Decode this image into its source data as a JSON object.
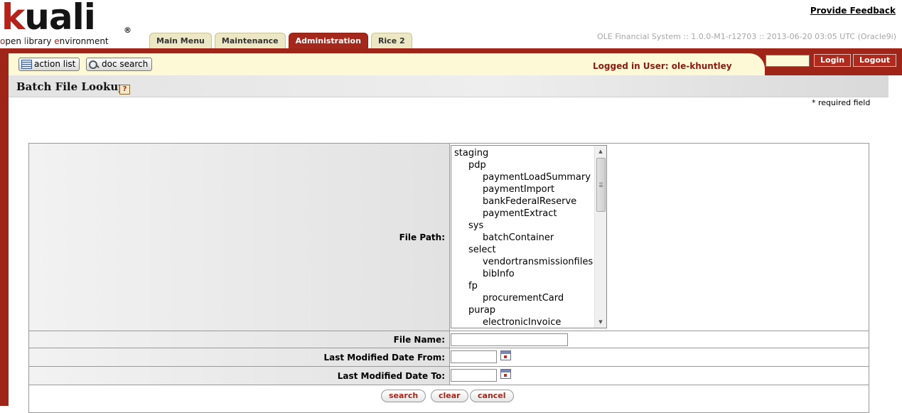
{
  "logo": {
    "word_k": "k",
    "word_rest": "uali",
    "registered": "®",
    "tagline": {
      "o": "o",
      "pen": "pen ",
      "l": "l",
      "ibrary": "ibrary ",
      "e": "e",
      "nvironment": "nvironment"
    }
  },
  "header": {
    "feedback_link": "Provide Feedback",
    "version": "OLE Financial System :: 1.0.0-M1-r12703 :: 2013-06-20 03:05 UTC (Oracle9i)",
    "tabs": [
      {
        "label": "Main Menu",
        "active": false
      },
      {
        "label": "Maintenance",
        "active": false
      },
      {
        "label": "Administration",
        "active": true
      },
      {
        "label": "Rice 2",
        "active": false
      }
    ]
  },
  "toolbar": {
    "action_list": "action list",
    "doc_search": "doc search",
    "logged_in": "Logged in User: ole-khuntley",
    "login_value": "",
    "login_button": "Login",
    "logout_button": "Logout"
  },
  "page": {
    "title": "Batch File Lookup",
    "help_glyph": "?",
    "required_note": "* required field"
  },
  "form": {
    "file_path_label": "File Path:",
    "file_path_tree": [
      {
        "label": "staging",
        "level": 0
      },
      {
        "label": "pdp",
        "level": 1
      },
      {
        "label": "paymentLoadSummary",
        "level": 2
      },
      {
        "label": "paymentImport",
        "level": 2
      },
      {
        "label": "bankFederalReserve",
        "level": 2
      },
      {
        "label": "paymentExtract",
        "level": 2
      },
      {
        "label": "sys",
        "level": 1
      },
      {
        "label": "batchContainer",
        "level": 2
      },
      {
        "label": "select",
        "level": 1
      },
      {
        "label": "vendortransmissionfiles",
        "level": 2
      },
      {
        "label": "bibInfo",
        "level": 2
      },
      {
        "label": "fp",
        "level": 1
      },
      {
        "label": "procurementCard",
        "level": 2
      },
      {
        "label": "purap",
        "level": 1
      },
      {
        "label": "electronicInvoice",
        "level": 2
      }
    ],
    "file_name_label": "File Name:",
    "file_name_value": "",
    "date_from_label": "Last Modified Date From:",
    "date_from_value": "",
    "date_to_label": "Last Modified Date To:",
    "date_to_value": "",
    "buttons": {
      "search": "search",
      "clear": "clear",
      "cancel": "cancel"
    }
  },
  "colors": {
    "brand_red": "#9e2518",
    "active_tab": "#a4281c",
    "toolbar_cream": "#fdf9d6",
    "tab_inactive": "#ece7c5"
  }
}
